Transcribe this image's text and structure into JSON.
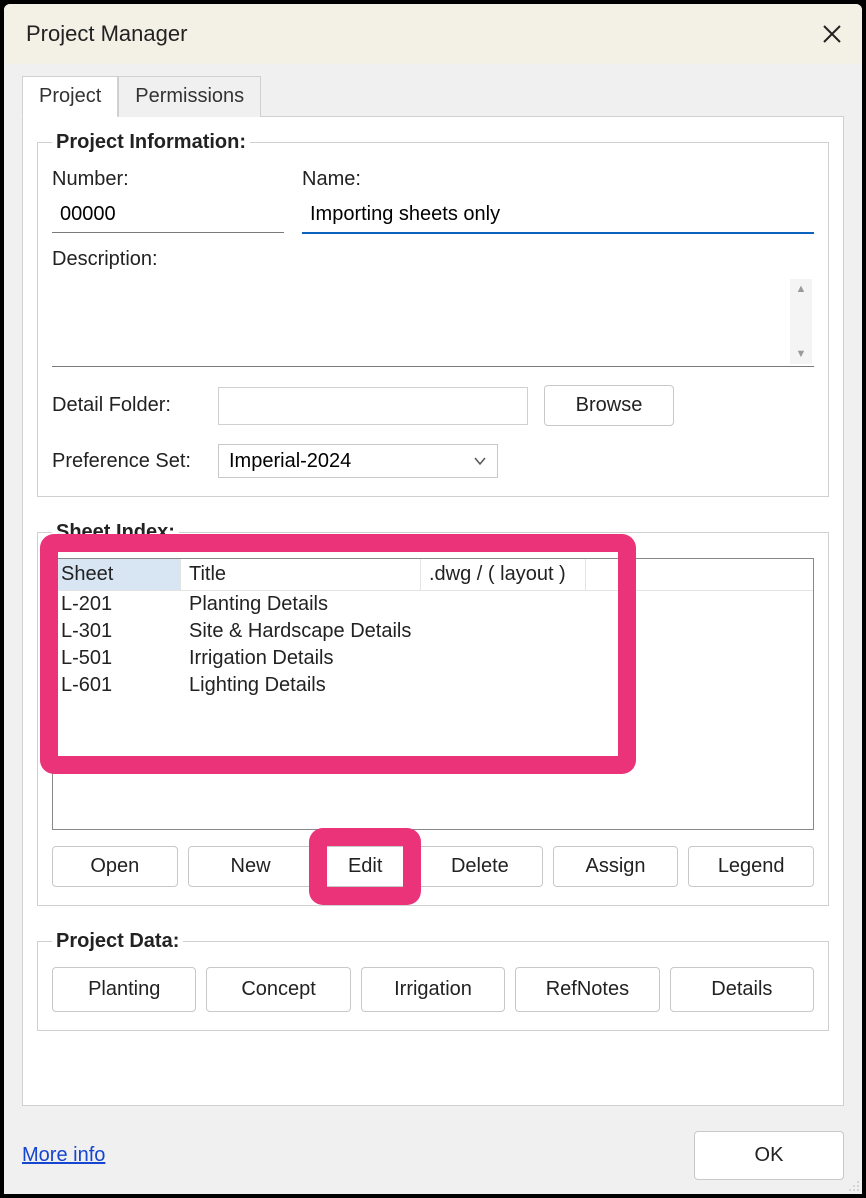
{
  "window": {
    "title": "Project Manager"
  },
  "tabs": {
    "project": "Project",
    "permissions": "Permissions"
  },
  "project_info": {
    "legend": "Project Information:",
    "number_label": "Number:",
    "number_value": "00000",
    "name_label": "Name:",
    "name_value": "Importing sheets only",
    "description_label": "Description:",
    "description_value": "",
    "detail_folder_label": "Detail Folder:",
    "detail_folder_value": "",
    "browse": "Browse",
    "pref_set_label": "Preference Set:",
    "pref_set_value": "Imperial-2024"
  },
  "sheet_index": {
    "legend": "Sheet Index:",
    "headers": {
      "sheet": "Sheet",
      "title": "Title",
      "dwg": ".dwg / ( layout )"
    },
    "rows": [
      {
        "sheet": "L-201",
        "title": "Planting Details"
      },
      {
        "sheet": "L-301",
        "title": "Site & Hardscape Details"
      },
      {
        "sheet": "L-501",
        "title": "Irrigation Details"
      },
      {
        "sheet": "L-601",
        "title": "Lighting Details"
      }
    ],
    "buttons": {
      "open": "Open",
      "new": "New",
      "edit": "Edit",
      "delete": "Delete",
      "assign": "Assign",
      "legend": "Legend"
    }
  },
  "project_data": {
    "legend": "Project Data:",
    "buttons": {
      "planting": "Planting",
      "concept": "Concept",
      "irrigation": "Irrigation",
      "refnotes": "RefNotes",
      "details": "Details"
    }
  },
  "footer": {
    "more_info": "More info",
    "ok": "OK"
  }
}
